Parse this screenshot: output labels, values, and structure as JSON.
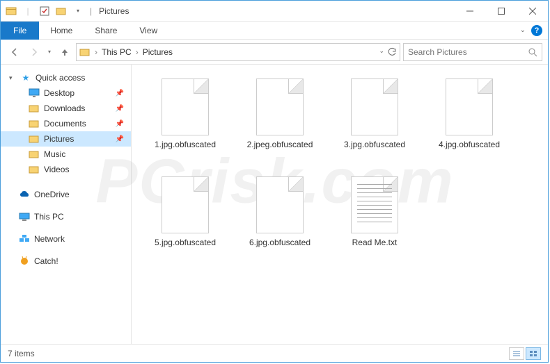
{
  "title": "Pictures",
  "ribbon": {
    "file": "File",
    "tabs": [
      "Home",
      "Share",
      "View"
    ]
  },
  "nav": {
    "crumbs": [
      "This PC",
      "Pictures"
    ],
    "search_placeholder": "Search Pictures"
  },
  "sidebar": {
    "quick_access": {
      "label": "Quick access",
      "expanded": true
    },
    "quick_items": [
      {
        "label": "Desktop",
        "pinned": true,
        "icon": "desktop"
      },
      {
        "label": "Downloads",
        "pinned": true,
        "icon": "folder"
      },
      {
        "label": "Documents",
        "pinned": true,
        "icon": "folder"
      },
      {
        "label": "Pictures",
        "pinned": true,
        "icon": "folder",
        "selected": true
      },
      {
        "label": "Music",
        "pinned": false,
        "icon": "folder"
      },
      {
        "label": "Videos",
        "pinned": false,
        "icon": "folder"
      }
    ],
    "roots": [
      {
        "label": "OneDrive",
        "icon": "cloud",
        "color": "#0a63b1"
      },
      {
        "label": "This PC",
        "icon": "pc",
        "color": "#2a7ab0"
      },
      {
        "label": "Network",
        "icon": "network",
        "color": "#2a7ab0"
      },
      {
        "label": "Catch!",
        "icon": "catch",
        "color": "#f0a020"
      }
    ]
  },
  "files": [
    {
      "name": "1.jpg.obfuscated",
      "type": "file"
    },
    {
      "name": "2.jpeg.obfuscated",
      "type": "file"
    },
    {
      "name": "3.jpg.obfuscated",
      "type": "file"
    },
    {
      "name": "4.jpg.obfuscated",
      "type": "file"
    },
    {
      "name": "5.jpg.obfuscated",
      "type": "file"
    },
    {
      "name": "6.jpg.obfuscated",
      "type": "file"
    },
    {
      "name": "Read Me.txt",
      "type": "txt"
    }
  ],
  "status": {
    "item_count": "7 items"
  },
  "watermark": "PCrisk.com"
}
